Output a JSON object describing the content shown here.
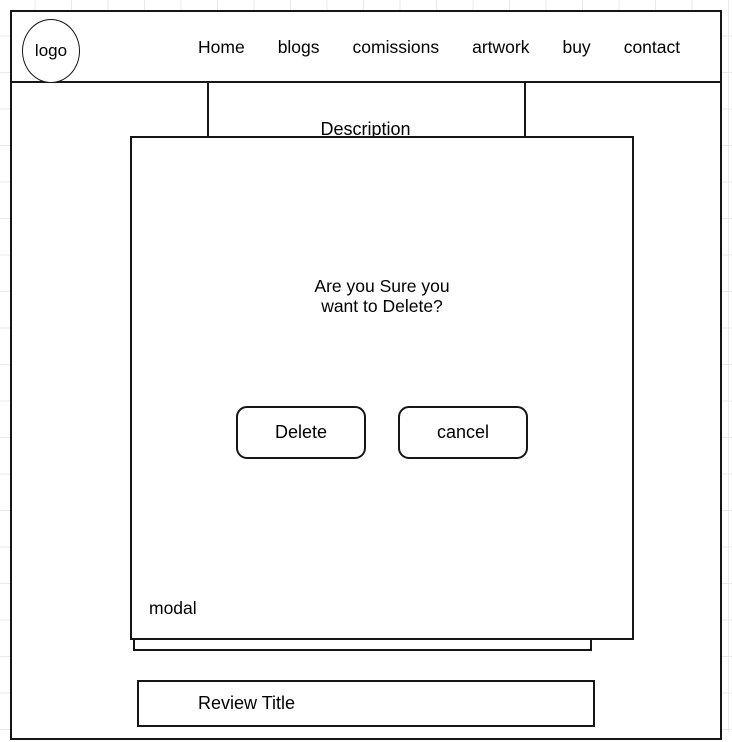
{
  "page": {
    "background": "#ffffff",
    "grid_color": "#e9e9e9",
    "line_color": "#161616"
  },
  "header": {
    "logo_label": "logo",
    "nav_items": [
      {
        "label": "Home"
      },
      {
        "label": "blogs"
      },
      {
        "label": "comissions"
      },
      {
        "label": "artwork"
      },
      {
        "label": "buy"
      },
      {
        "label": "contact"
      }
    ]
  },
  "content": {
    "description_label": "Description",
    "review_title": "Review Title"
  },
  "modal": {
    "caption": "modal",
    "message_line1": "Are you Sure you",
    "message_line2": "want to Delete?",
    "confirm_label": "Delete",
    "cancel_label": "cancel"
  }
}
